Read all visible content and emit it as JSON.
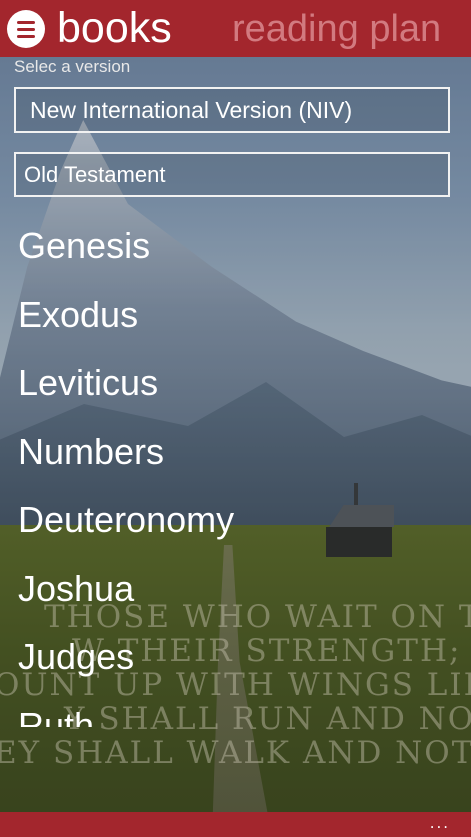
{
  "header": {
    "active_tab": "books",
    "next_tab": "reading plan"
  },
  "version_label": "Selec a version",
  "version_select": {
    "value": "New International Version (NIV)"
  },
  "testament_select": {
    "value": "Old Testament"
  },
  "books": [
    "Genesis",
    "Exodus",
    "Leviticus",
    "Numbers",
    "Deuteronomy",
    "Joshua",
    "Judges",
    "Ruth"
  ],
  "background_verse": [
    "THOSE WHO WAIT ON THE L",
    "W THEIR STRENGTH;",
    "OUNT UP WITH WINGS LIKE",
    "Y SHALL RUN AND NOT BE WE",
    "EY SHALL WALK AND NOT FA"
  ],
  "appbar": {
    "more_label": "..."
  },
  "colors": {
    "accent": "#a3262d",
    "inactive_tab": "#d27a80",
    "text": "#ffffff"
  },
  "icons": {
    "menu": "hamburger-menu-icon"
  }
}
